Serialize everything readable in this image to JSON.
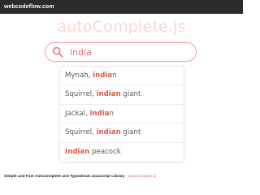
{
  "topbar": {
    "brand": "webcodeflow.com"
  },
  "header": {
    "title": "autoComplete.js"
  },
  "search": {
    "value": "india",
    "placeholder": "",
    "icon": "search-icon"
  },
  "results": [
    {
      "before": "Mynah, ",
      "match": "india",
      "after": "n"
    },
    {
      "before": "Squirrel, ",
      "match": "indian",
      "after": " giant"
    },
    {
      "before": "Jackal, ",
      "match": "india",
      "after": "n"
    },
    {
      "before": "Squirrel, ",
      "match": "indian",
      "after": " giant"
    },
    {
      "before": "",
      "match": "Indian",
      "after": " peacock"
    }
  ],
  "footer": {
    "text": "Simple and Fast Autocomplete and Typeahead Javascript Library ",
    "separator": "- ",
    "link": "autoComplete.js"
  },
  "colors": {
    "accent": "#e0574f",
    "title": "#fbd6d6",
    "topbar": "#2b2b2b"
  }
}
